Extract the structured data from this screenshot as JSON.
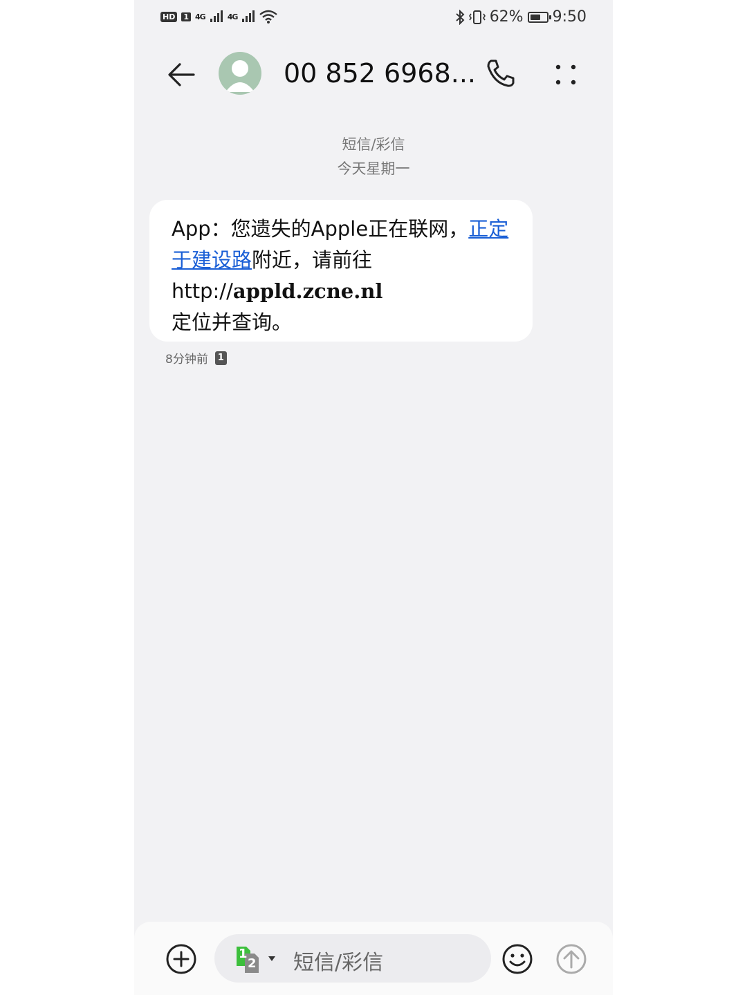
{
  "status_bar": {
    "hd": "HD",
    "sim": "1",
    "network1": "4G",
    "network2": "4G",
    "battery_pct": "62%",
    "battery_level": 0.62,
    "time": "9:50"
  },
  "header": {
    "contact": "00 852 6968...",
    "icons": {
      "back": "back-arrow-icon",
      "call": "phone-icon",
      "more": "more-dots-icon"
    }
  },
  "thread": {
    "type_label": "短信/彩信",
    "day_label": "今天星期一"
  },
  "message": {
    "part1": "App：您遗失的Apple正在联网，",
    "link_text": "正定于建设路",
    "part2": "附近，请前往",
    "url_scheme": "http://",
    "url_host": "appld.zcne.nl",
    "part3": "定位并查询。",
    "time": "8分钟前",
    "sim_badge": "1"
  },
  "composer": {
    "placeholder": "短信/彩信",
    "sim_primary": "1",
    "sim_secondary": "2",
    "colors": {
      "sim_active": "#3cbf3c",
      "sim_inactive": "#8a8a8a"
    }
  }
}
